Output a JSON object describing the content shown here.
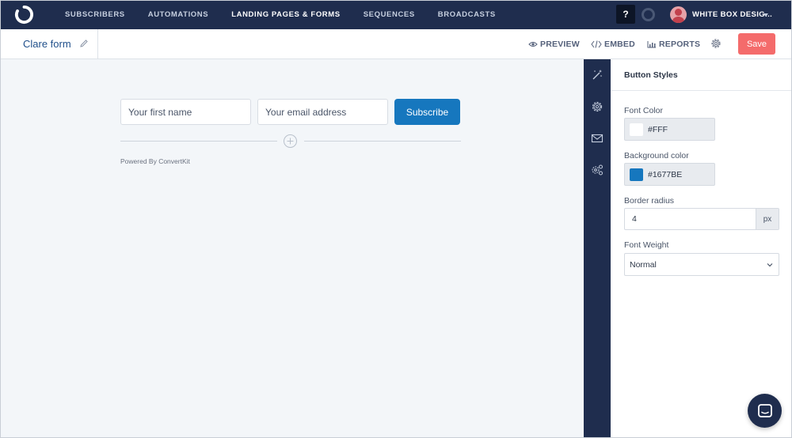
{
  "nav": {
    "items": [
      {
        "label": "SUBSCRIBERS",
        "active": false
      },
      {
        "label": "AUTOMATIONS",
        "active": false
      },
      {
        "label": "LANDING PAGES & FORMS",
        "active": true
      },
      {
        "label": "SEQUENCES",
        "active": false
      },
      {
        "label": "BROADCASTS",
        "active": false
      }
    ],
    "help_label": "?",
    "user_name": "WHITE BOX DESIG..."
  },
  "header": {
    "form_title": "Clare form",
    "preview_label": "PREVIEW",
    "embed_label": "EMBED",
    "reports_label": "REPORTS",
    "save_label": "Save"
  },
  "form": {
    "first_name_placeholder": "Your first name",
    "email_placeholder": "Your email address",
    "subscribe_label": "Subscribe",
    "powered_by": "Powered By ConvertKit"
  },
  "panel": {
    "title": "Button Styles",
    "font_color_label": "Font Color",
    "font_color_value": "#FFF",
    "bg_color_label": "Background color",
    "bg_color_value": "#1677BE",
    "border_radius_label": "Border radius",
    "border_radius_value": "4",
    "border_radius_unit": "px",
    "font_weight_label": "Font Weight",
    "font_weight_value": "Normal"
  },
  "colors": {
    "nav_bg": "#1f2d4e",
    "button_bg": "#1677be",
    "save_bg": "#f46b6b"
  }
}
